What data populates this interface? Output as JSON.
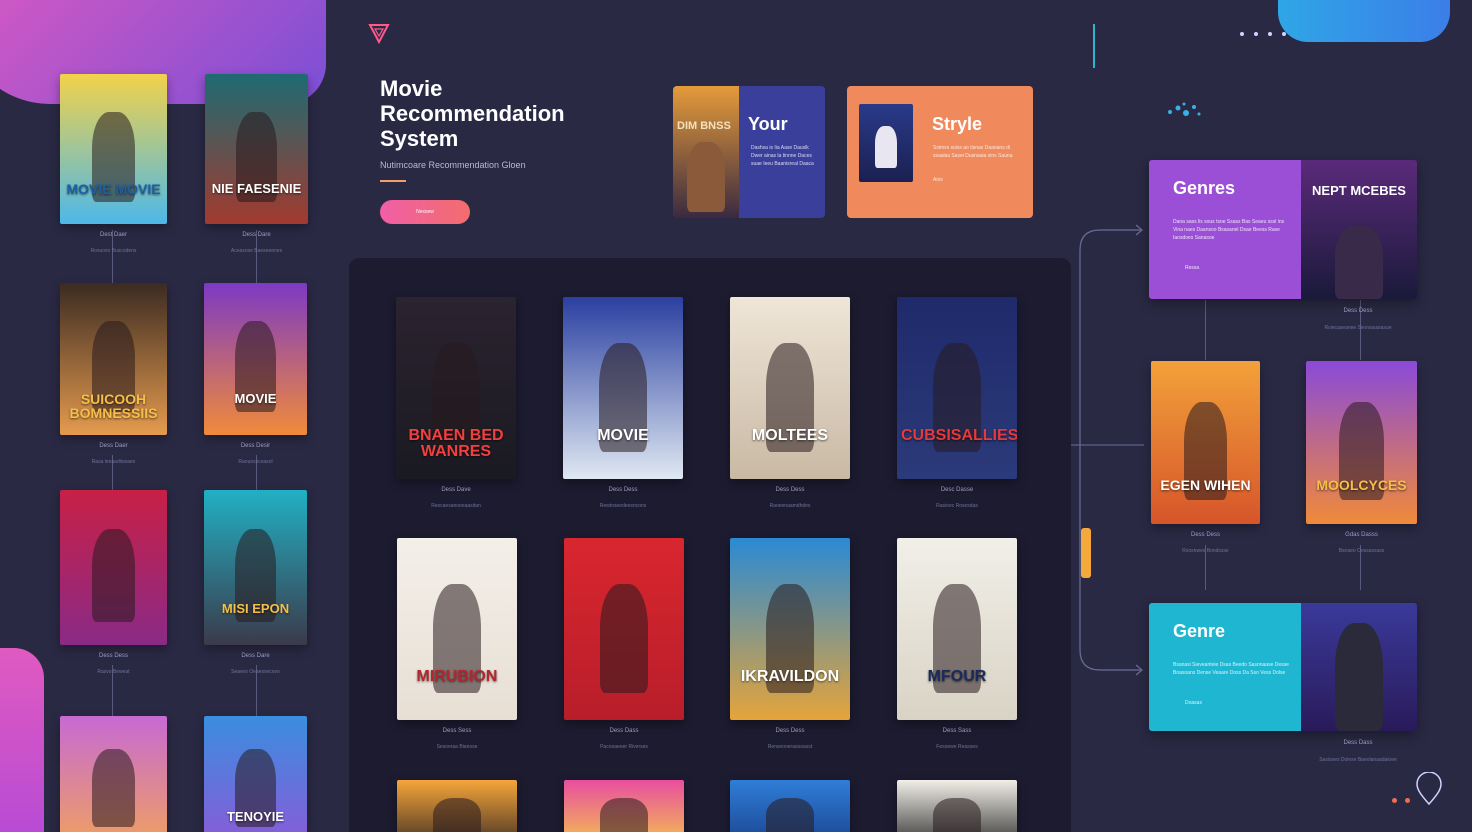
{
  "colors": {
    "background": "#2a2944",
    "panel": "#1c1b30",
    "accent_pink": "#f05fa6",
    "accent_orange": "#f08a5d",
    "genre_purple": "#9b4fd6",
    "genre_teal": "#1fb6d2",
    "card_blue": "#3b3f9c"
  },
  "header": {
    "title_line1": "Movie",
    "title_line2": "Recommendation",
    "title_line3": "System",
    "subtitle": "Nutimcoare Recommendation Gloen",
    "cta_label": "Nexsew"
  },
  "top_cards": {
    "your": {
      "title": "Your",
      "poster_text": "DIM BNSS",
      "body": "Dashsa is Iia Aase Dauslk Dwer ainas la tinnne Daces suae Ieeu Baanisreal Daaca"
    },
    "style": {
      "title": "Stryle",
      "body": "Ssimvs soiss ao tisnas Daanans di ssaalas Sasei Dusnaaia sins Sauna",
      "meta": "Anis"
    }
  },
  "left_posters": [
    {
      "title": "MOVIE MOVIE",
      "caption": "Dest Daer",
      "sub": "Rosuoxo Buscodens",
      "top": "#f2d24a",
      "bottom": "#4db8e8",
      "text_color": "#1a5fa8"
    },
    {
      "title": "NIE FAESENIE",
      "caption": "Dess Dare",
      "sub": "Aceasose Baeseeenes",
      "top": "#1d6b72",
      "bottom": "#a23a2f",
      "text_color": "#ffffff"
    },
    {
      "title": "SUICOOH BOMNESSIIS",
      "caption": "Dess Daer",
      "sub": "Rasa lenaadiiseaes",
      "top": "#3b2b22",
      "bottom": "#e59b4e",
      "text_color": "#f5c04a"
    },
    {
      "title": "MOVIE",
      "caption": "Dess Desir",
      "sub": "Raouosscoasol",
      "top": "#7c3ac4",
      "bottom": "#f08a3a",
      "text_color": "#ffffff"
    },
    {
      "title": "",
      "caption": "Dess Dess",
      "sub": "Rasvo Beweat",
      "top": "#c82046",
      "bottom": "#8a2a86",
      "text_color": "#ffffff"
    },
    {
      "title": "MISI EPON",
      "caption": "Dess Dare",
      "sub": "Seaevs Oeaessecovo",
      "top": "#22b0c4",
      "bottom": "#3b3a4a",
      "text_color": "#f5c04a"
    },
    {
      "title": "",
      "caption": "",
      "sub": "",
      "top": "#c66ad4",
      "bottom": "#f0a060",
      "text_color": "#ffffff"
    },
    {
      "title": "TENOYIE",
      "caption": "",
      "sub": "",
      "top": "#3a8ee0",
      "bottom": "#8a5ad8",
      "text_color": "#ffffff"
    }
  ],
  "grid_posters": [
    {
      "title": "BNAEN BED WANRES",
      "caption": "Dess Dave",
      "sub": "Rescaesanoeeaasitan",
      "top": "#2b2330",
      "bottom": "#1a1a22",
      "text_color": "#f24040"
    },
    {
      "title": "MOVIE",
      "caption": "Dess Dess",
      "sub": "Rewtoseedeesncons",
      "top": "#2a3fa0",
      "bottom": "#dfe8f2",
      "text_color": "#ffffff"
    },
    {
      "title": "MOLTEES",
      "caption": "Dess Dess",
      "sub": "Raoeenaamdhdes",
      "top": "#efe6d8",
      "bottom": "#c9b9a4",
      "text_color": "#ffffff"
    },
    {
      "title": "CUBSISALLIES",
      "caption": "Desc Dasse",
      "sub": "Rasioec Rosesdas",
      "top": "#1f2a6b",
      "bottom": "#2b3a7a",
      "text_color": "#e5393a"
    },
    {
      "title": "MIRUBION",
      "caption": "Dess Sess",
      "sub": "Sesoeraa Bianose",
      "top": "#f3efe9",
      "bottom": "#e7dfd4",
      "text_color": "#b3262e"
    },
    {
      "title": "",
      "caption": "Dess Dass",
      "sub": "Pacooaeeer Riverses",
      "top": "#d9262e",
      "bottom": "#b81e2a",
      "text_color": "#ffffff"
    },
    {
      "title": "IKRAVILDON",
      "caption": "Dess Dess",
      "sub": "Renseooerasooasst",
      "top": "#2a8ad4",
      "bottom": "#e5a43a",
      "text_color": "#ffffff"
    },
    {
      "title": "MFOUR",
      "caption": "Dess Sass",
      "sub": "Fesoewe Reasoes",
      "top": "#f1efe8",
      "bottom": "#d9d3c5",
      "text_color": "#1a2a5a"
    },
    {
      "title": "",
      "caption": "",
      "sub": "",
      "top": "#f5a63a",
      "bottom": "#3b2a22",
      "text_color": "#ffffff"
    },
    {
      "title": "",
      "caption": "",
      "sub": "",
      "top": "#e84ea0",
      "bottom": "#f5c84a",
      "text_color": "#ffffff"
    },
    {
      "title": "",
      "caption": "",
      "sub": "",
      "top": "#2f7ed8",
      "bottom": "#1a3f8a",
      "text_color": "#ffffff"
    },
    {
      "title": "",
      "caption": "",
      "sub": "",
      "top": "#f2efe8",
      "bottom": "#2a2a2a",
      "text_color": "#ffffff"
    }
  ],
  "genre_cards": [
    {
      "title": "Genres",
      "body": "Dana sass lis sous tsoe Ssass Bas Seaeu sssl ins Vina naes Daansoo Bsasanel Dsae Beess Rase Iaosdoes Sanasoe",
      "meta": "Ressa",
      "poster_title": "NEPT MCEBES",
      "caption": "Dess Dess",
      "sub": "Rsiecaseanee Sieovasasasue"
    },
    {
      "title": "Genre",
      "body": "Bsanasi Sieveanteie Dsas Beedo Sasonaase Desse Boasoans Dense Veaare Doss Da Sso Vess Dolse",
      "meta": "Doasas",
      "poster_title": "",
      "caption": "Dess Dass",
      "sub": "Sasisoes Dolese Baeolanaadaioee"
    }
  ],
  "right_posters": [
    {
      "title": "EGEN WIHEN",
      "caption": "Dess Dess",
      "sub": "Rsosnwes Bondssse",
      "top": "#f2a13a",
      "bottom": "#d6552a",
      "text_color": "#ffffff"
    },
    {
      "title": "MOOLCYCES",
      "caption": "Gdas Dasss",
      "sub": "Bsnaeo Oessassass",
      "top": "#8a4ad8",
      "bottom": "#f08a3a",
      "text_color": "#f5c04a"
    }
  ]
}
